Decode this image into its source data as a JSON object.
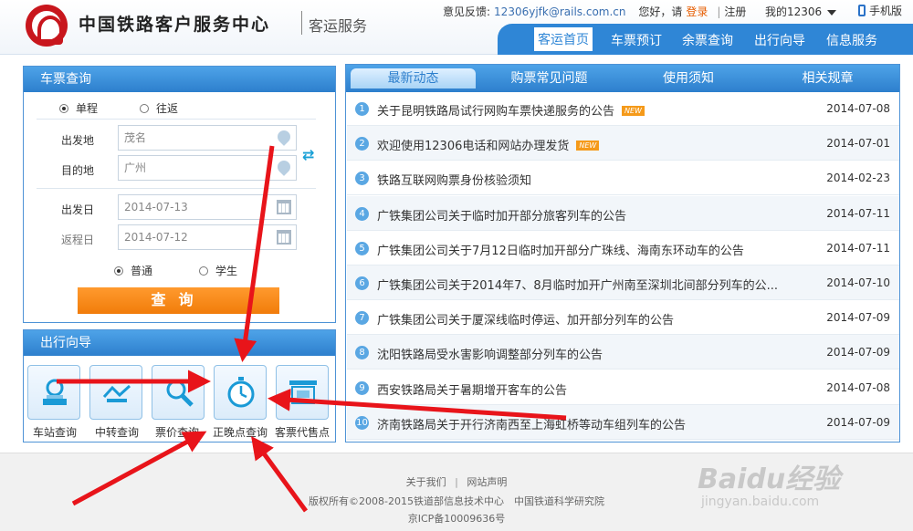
{
  "header": {
    "brand_name": "中国铁路客户服务中心",
    "brand_sub": "客运服务",
    "feedback_label": "意见反馈:",
    "feedback_email": "12306yjfk@rails.com.cn",
    "greeting": "您好，请",
    "login": "登录",
    "register": "注册",
    "my12306": "我的12306",
    "mobile": "手机版"
  },
  "nav": [
    "客运首页",
    "车票预订",
    "余票查询",
    "出行向导",
    "信息服务"
  ],
  "ticket_query": {
    "title": "车票查询",
    "one_way": "单程",
    "round_trip": "往返",
    "from_label": "出发地",
    "from_value": "茂名",
    "to_label": "目的地",
    "to_value": "广州",
    "depart_label": "出发日",
    "depart_value": "2014-07-13",
    "return_label": "返程日",
    "return_value": "2014-07-12",
    "normal": "普通",
    "student": "学生",
    "query_button": "查询"
  },
  "guide": {
    "title": "出行向导",
    "items": [
      "车站查询",
      "中转查询",
      "票价查询",
      "正晚点查询",
      "客票代售点"
    ]
  },
  "news": {
    "tabs": [
      "最新动态",
      "购票常见问题",
      "使用须知",
      "相关规章"
    ],
    "new_badge": "NEW",
    "items": [
      {
        "num": "1",
        "title": "关于昆明铁路局试行网购车票快递服务的公告",
        "date": "2014-07-08",
        "is_new": true
      },
      {
        "num": "2",
        "title": "欢迎使用12306电话和网站办理发货",
        "date": "2014-07-01",
        "is_new": true
      },
      {
        "num": "3",
        "title": "铁路互联网购票身份核验须知",
        "date": "2014-02-23",
        "is_new": false
      },
      {
        "num": "4",
        "title": "广铁集团公司关于临时加开部分旅客列车的公告",
        "date": "2014-07-11",
        "is_new": false
      },
      {
        "num": "5",
        "title": "广铁集团公司关于7月12日临时加开部分广珠线、海南东环动车的公告",
        "date": "2014-07-11",
        "is_new": false
      },
      {
        "num": "6",
        "title": "广铁集团公司关于2014年7、8月临时加开广州南至深圳北间部分列车的公...",
        "date": "2014-07-10",
        "is_new": false
      },
      {
        "num": "7",
        "title": "广铁集团公司关于厦深线临时停运、加开部分列车的公告",
        "date": "2014-07-09",
        "is_new": false
      },
      {
        "num": "8",
        "title": "沈阳铁路局受水害影响调整部分列车的公告",
        "date": "2014-07-09",
        "is_new": false
      },
      {
        "num": "9",
        "title": "西安铁路局关于暑期增开客车的公告",
        "date": "2014-07-08",
        "is_new": false
      },
      {
        "num": "10",
        "title": "济南铁路局关于开行济南西至上海虹桥等动车组列车的公告",
        "date": "2014-07-09",
        "is_new": false
      }
    ]
  },
  "footer": {
    "about": "关于我们",
    "statement": "网站声明",
    "copyright": "版权所有©2008-2015铁道部信息技术中心　中国铁道科学研究院",
    "icp": "京ICP备10009636号"
  },
  "watermark": {
    "main": "Baidu经验",
    "sub": "jingyan.baidu.com"
  },
  "colors": {
    "brand_red": "#c8161d",
    "nav_blue": "#2f86d6",
    "accent_orange": "#f17c0a",
    "arrow_red": "#e8141a"
  }
}
